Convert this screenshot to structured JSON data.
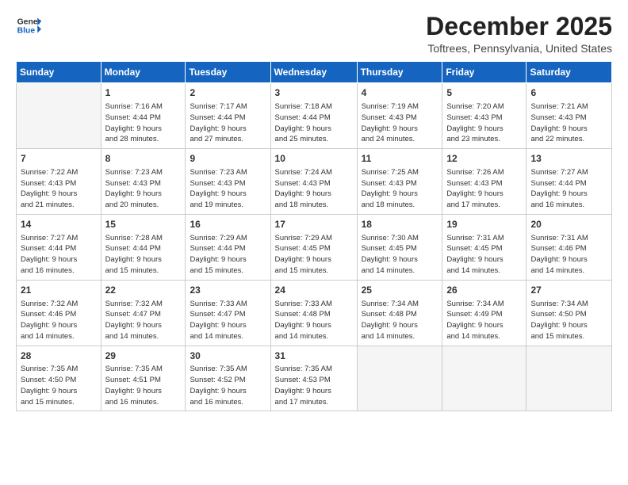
{
  "logo": {
    "line1": "General",
    "line2": "Blue"
  },
  "header": {
    "month": "December 2025",
    "location": "Toftrees, Pennsylvania, United States"
  },
  "days_of_week": [
    "Sunday",
    "Monday",
    "Tuesday",
    "Wednesday",
    "Thursday",
    "Friday",
    "Saturday"
  ],
  "weeks": [
    [
      {
        "day": "",
        "info": ""
      },
      {
        "day": "1",
        "info": "Sunrise: 7:16 AM\nSunset: 4:44 PM\nDaylight: 9 hours\nand 28 minutes."
      },
      {
        "day": "2",
        "info": "Sunrise: 7:17 AM\nSunset: 4:44 PM\nDaylight: 9 hours\nand 27 minutes."
      },
      {
        "day": "3",
        "info": "Sunrise: 7:18 AM\nSunset: 4:44 PM\nDaylight: 9 hours\nand 25 minutes."
      },
      {
        "day": "4",
        "info": "Sunrise: 7:19 AM\nSunset: 4:43 PM\nDaylight: 9 hours\nand 24 minutes."
      },
      {
        "day": "5",
        "info": "Sunrise: 7:20 AM\nSunset: 4:43 PM\nDaylight: 9 hours\nand 23 minutes."
      },
      {
        "day": "6",
        "info": "Sunrise: 7:21 AM\nSunset: 4:43 PM\nDaylight: 9 hours\nand 22 minutes."
      }
    ],
    [
      {
        "day": "7",
        "info": "Sunrise: 7:22 AM\nSunset: 4:43 PM\nDaylight: 9 hours\nand 21 minutes."
      },
      {
        "day": "8",
        "info": "Sunrise: 7:23 AM\nSunset: 4:43 PM\nDaylight: 9 hours\nand 20 minutes."
      },
      {
        "day": "9",
        "info": "Sunrise: 7:23 AM\nSunset: 4:43 PM\nDaylight: 9 hours\nand 19 minutes."
      },
      {
        "day": "10",
        "info": "Sunrise: 7:24 AM\nSunset: 4:43 PM\nDaylight: 9 hours\nand 18 minutes."
      },
      {
        "day": "11",
        "info": "Sunrise: 7:25 AM\nSunset: 4:43 PM\nDaylight: 9 hours\nand 18 minutes."
      },
      {
        "day": "12",
        "info": "Sunrise: 7:26 AM\nSunset: 4:43 PM\nDaylight: 9 hours\nand 17 minutes."
      },
      {
        "day": "13",
        "info": "Sunrise: 7:27 AM\nSunset: 4:44 PM\nDaylight: 9 hours\nand 16 minutes."
      }
    ],
    [
      {
        "day": "14",
        "info": "Sunrise: 7:27 AM\nSunset: 4:44 PM\nDaylight: 9 hours\nand 16 minutes."
      },
      {
        "day": "15",
        "info": "Sunrise: 7:28 AM\nSunset: 4:44 PM\nDaylight: 9 hours\nand 15 minutes."
      },
      {
        "day": "16",
        "info": "Sunrise: 7:29 AM\nSunset: 4:44 PM\nDaylight: 9 hours\nand 15 minutes."
      },
      {
        "day": "17",
        "info": "Sunrise: 7:29 AM\nSunset: 4:45 PM\nDaylight: 9 hours\nand 15 minutes."
      },
      {
        "day": "18",
        "info": "Sunrise: 7:30 AM\nSunset: 4:45 PM\nDaylight: 9 hours\nand 14 minutes."
      },
      {
        "day": "19",
        "info": "Sunrise: 7:31 AM\nSunset: 4:45 PM\nDaylight: 9 hours\nand 14 minutes."
      },
      {
        "day": "20",
        "info": "Sunrise: 7:31 AM\nSunset: 4:46 PM\nDaylight: 9 hours\nand 14 minutes."
      }
    ],
    [
      {
        "day": "21",
        "info": "Sunrise: 7:32 AM\nSunset: 4:46 PM\nDaylight: 9 hours\nand 14 minutes."
      },
      {
        "day": "22",
        "info": "Sunrise: 7:32 AM\nSunset: 4:47 PM\nDaylight: 9 hours\nand 14 minutes."
      },
      {
        "day": "23",
        "info": "Sunrise: 7:33 AM\nSunset: 4:47 PM\nDaylight: 9 hours\nand 14 minutes."
      },
      {
        "day": "24",
        "info": "Sunrise: 7:33 AM\nSunset: 4:48 PM\nDaylight: 9 hours\nand 14 minutes."
      },
      {
        "day": "25",
        "info": "Sunrise: 7:34 AM\nSunset: 4:48 PM\nDaylight: 9 hours\nand 14 minutes."
      },
      {
        "day": "26",
        "info": "Sunrise: 7:34 AM\nSunset: 4:49 PM\nDaylight: 9 hours\nand 14 minutes."
      },
      {
        "day": "27",
        "info": "Sunrise: 7:34 AM\nSunset: 4:50 PM\nDaylight: 9 hours\nand 15 minutes."
      }
    ],
    [
      {
        "day": "28",
        "info": "Sunrise: 7:35 AM\nSunset: 4:50 PM\nDaylight: 9 hours\nand 15 minutes."
      },
      {
        "day": "29",
        "info": "Sunrise: 7:35 AM\nSunset: 4:51 PM\nDaylight: 9 hours\nand 16 minutes."
      },
      {
        "day": "30",
        "info": "Sunrise: 7:35 AM\nSunset: 4:52 PM\nDaylight: 9 hours\nand 16 minutes."
      },
      {
        "day": "31",
        "info": "Sunrise: 7:35 AM\nSunset: 4:53 PM\nDaylight: 9 hours\nand 17 minutes."
      },
      {
        "day": "",
        "info": ""
      },
      {
        "day": "",
        "info": ""
      },
      {
        "day": "",
        "info": ""
      }
    ]
  ]
}
